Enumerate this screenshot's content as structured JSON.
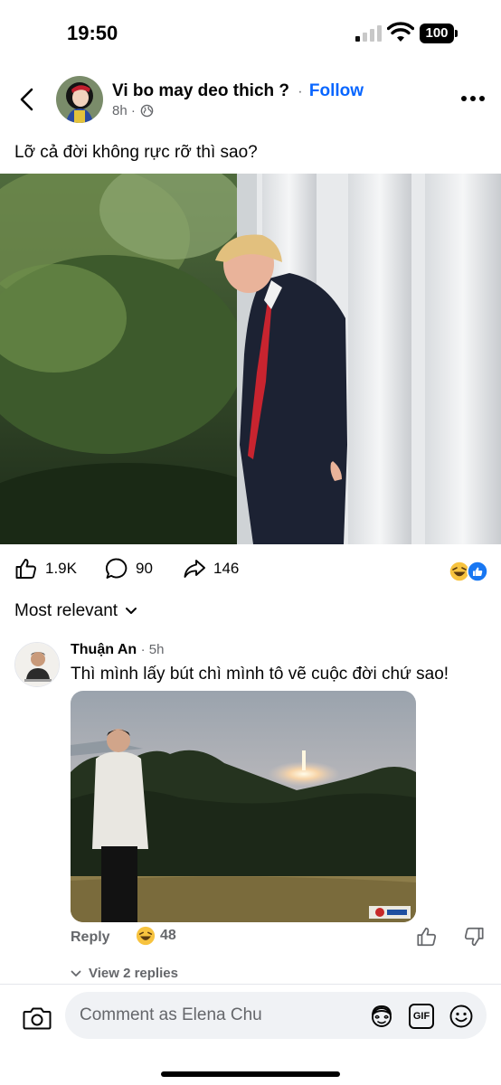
{
  "status_bar": {
    "time": "19:50",
    "battery": "100"
  },
  "post": {
    "author": "Vi bo may deo thich ?",
    "separator": "·",
    "follow_label": "Follow",
    "time": "8h ·",
    "caption": "Lỡ cả đời không rực rỡ thì sao?",
    "image_icon": "photo-person-walking",
    "stats": {
      "likes": "1.9K",
      "comments": "90",
      "shares": "146"
    },
    "reaction_icons": [
      "haha-icon",
      "like-icon"
    ]
  },
  "comments_section": {
    "sort_label": "Most relevant",
    "comments": [
      {
        "author": "Thuận An",
        "time": "· 5h",
        "text": "Thì mình lấy bút chì mình tô vẽ cuộc đời chứ sao!",
        "reply_label": "Reply",
        "reaction_count": "48",
        "view_replies": "View 2 replies"
      }
    ]
  },
  "composer": {
    "placeholder": "Comment as Elena Chu",
    "gif_label": "GIF"
  },
  "colors": {
    "accent": "#0866ff",
    "secondary_text": "#65676b",
    "input_bg": "#f0f2f5"
  }
}
